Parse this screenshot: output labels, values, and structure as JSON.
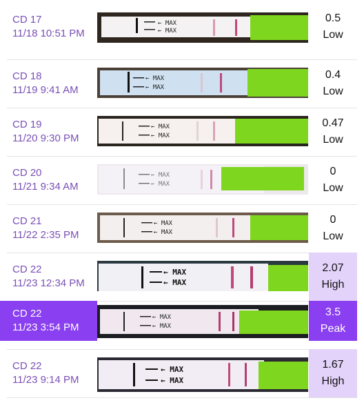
{
  "tests": [
    {
      "cd": "CD 17",
      "datetime": "11/18 10:51 PM",
      "value": "0.5",
      "level": "Low"
    },
    {
      "cd": "CD 18",
      "datetime": "11/19 9:41 AM",
      "value": "0.4",
      "level": "Low"
    },
    {
      "cd": "CD 19",
      "datetime": "11/20 9:30 PM",
      "value": "0.47",
      "level": "Low"
    },
    {
      "cd": "CD 20",
      "datetime": "11/21 9:34 AM",
      "value": "0",
      "level": "Low"
    },
    {
      "cd": "CD 21",
      "datetime": "11/22 2:35 PM",
      "value": "0",
      "level": "Low"
    },
    {
      "cd": "CD 22",
      "datetime": "11/23 12:34 PM",
      "value": "2.07",
      "level": "High"
    },
    {
      "cd": "CD 22",
      "datetime": "11/23 3:54 PM",
      "value": "3.5",
      "level": "Peak"
    },
    {
      "cd": "CD 22",
      "datetime": "11/23 9:14 PM",
      "value": "1.67",
      "level": "High"
    }
  ],
  "strip_text": "MAX",
  "colors": {
    "accent": "#8a3ff0",
    "label_purple": "#7a4fb6",
    "high_bg": "#e3d3fa",
    "strip_green": "#7ed61e",
    "test_line": "#c0487a"
  }
}
